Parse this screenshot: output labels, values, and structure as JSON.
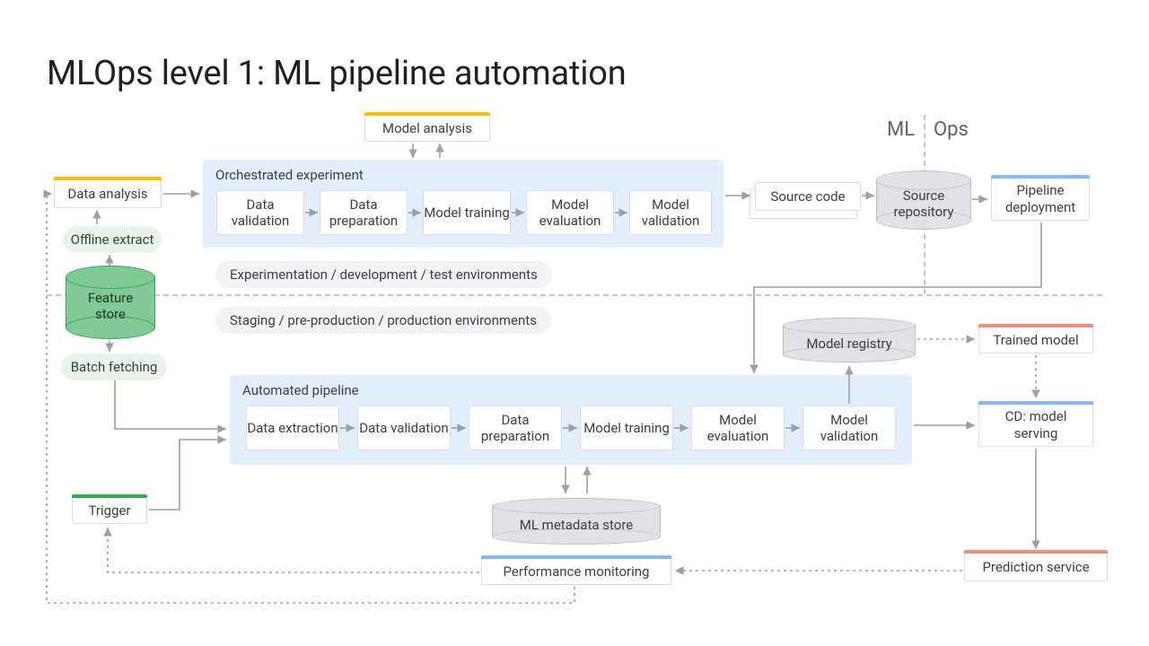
{
  "title": "MLOps level 1: ML pipeline automation",
  "mlops": {
    "ml": "ML",
    "ops": "Ops"
  },
  "top": {
    "data_analysis": "Data analysis",
    "model_analysis": "Model analysis",
    "source_code": "Source code",
    "pipeline_deployment": "Pipeline\ndeployment"
  },
  "experiment": {
    "label": "Orchestrated experiment",
    "steps": {
      "s1": "Data\nvalidation",
      "s2": "Data\npreparation",
      "s3": "Model\ntraining",
      "s4": "Model\nevaluation",
      "s5": "Model\nvalidation"
    }
  },
  "pipeline": {
    "label": "Automated pipeline",
    "steps": {
      "p1": "Data\nextraction",
      "p2": "Data\nvalidation",
      "p3": "Data\npreparation",
      "p4": "Model\ntraining",
      "p5": "Model\nevaluation",
      "p6": "Model\nvalidation"
    }
  },
  "stores": {
    "feature_store": "Feature\nstore",
    "source_repo": "Source\nrepository",
    "model_registry": "Model registry",
    "ml_metadata": "ML metadata store"
  },
  "pills": {
    "offline_extract": "Offline extract",
    "batch_fetching": "Batch fetching"
  },
  "chips": {
    "env_top": "Experimentation / development / test environments",
    "env_bottom": "Staging / pre-production / production environments"
  },
  "other": {
    "trigger": "Trigger",
    "trained_model": "Trained model",
    "cd_serving": "CD: model\nserving",
    "prediction_service": "Prediction service",
    "perf_monitor": "Performance monitoring"
  }
}
